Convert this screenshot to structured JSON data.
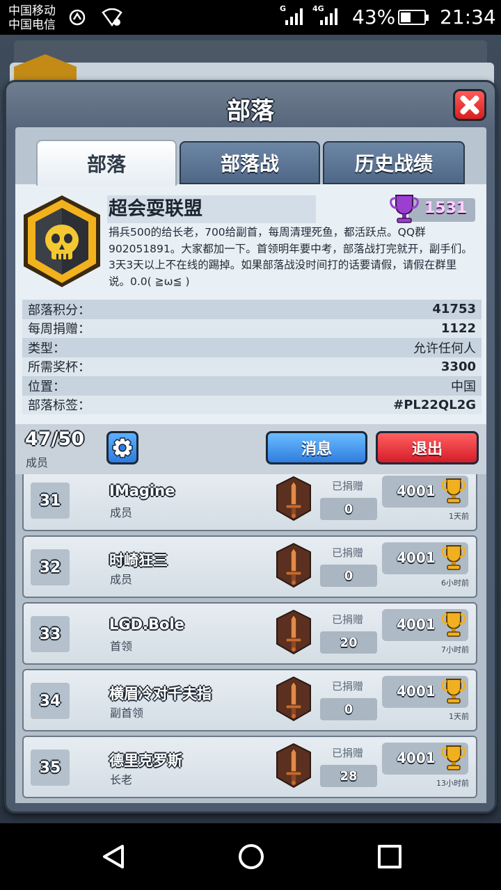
{
  "status_bar": {
    "carrier1": "中国移动",
    "carrier2": "中国电信",
    "signal1_tag": "G",
    "signal2_tag": "4G",
    "battery": "43%",
    "battery_level": 0.43,
    "time": "21:34"
  },
  "panel": {
    "title": "部落",
    "tabs": [
      {
        "label": "部落",
        "active": true
      },
      {
        "label": "部落战",
        "active": false
      },
      {
        "label": "历史战绩",
        "active": false
      }
    ]
  },
  "clan": {
    "name": "超会耍联盟",
    "trophies": "1531",
    "description": "捐兵500的给长老，700给副首，每周清理死鱼，都活跃点。QQ群902051891。大家都加一下。首领明年要中考，部落战打完就开，副手们。3天3天以上不在线的踢掉。如果部落战没时间打的话要请假，请假在群里说。0.0( ≧ω≦ )",
    "stats": [
      {
        "label": "部落积分：",
        "value": "41753"
      },
      {
        "label": "每周捐赠：",
        "value": "1122"
      },
      {
        "label": "类型：",
        "value": "允许任何人"
      },
      {
        "label": "所需奖杯：",
        "value": "3300"
      },
      {
        "label": "位置：",
        "value": "中国"
      },
      {
        "label": "部落标签：",
        "value": "#PL22QL2G"
      }
    ]
  },
  "members_bar": {
    "count": "47/50",
    "label": "成员",
    "message_button": "消息",
    "leave_button": "退出"
  },
  "members": [
    {
      "rank": "31",
      "name": "IMagine",
      "role": "成员",
      "donated_label": "已捐赠",
      "donated": "0",
      "trophies": "4001",
      "last_seen": "1天前"
    },
    {
      "rank": "32",
      "name": "时崎狂三",
      "role": "成员",
      "donated_label": "已捐赠",
      "donated": "0",
      "trophies": "4001",
      "last_seen": "6小时前"
    },
    {
      "rank": "33",
      "name": "LGD.Bole",
      "role": "首领",
      "donated_label": "已捐赠",
      "donated": "20",
      "trophies": "4001",
      "last_seen": "7小时前"
    },
    {
      "rank": "34",
      "name": "横眉冷对千夫指",
      "role": "副首领",
      "donated_label": "已捐赠",
      "donated": "0",
      "trophies": "4001",
      "last_seen": "1天前"
    },
    {
      "rank": "35",
      "name": "德里克罗斯",
      "role": "长老",
      "donated_label": "已捐赠",
      "donated": "28",
      "trophies": "4001",
      "last_seen": "13小时前"
    }
  ],
  "icons": {
    "clan_badge": "skull-shield-icon",
    "clan_trophy": "purple-trophy-icon",
    "member_sword": "sword-icon",
    "member_trophy": "gold-trophy-icon",
    "settings": "gear-icon",
    "close": "close-icon"
  },
  "colors": {
    "clan_trophy": "#9a3fd0",
    "member_trophy": "#f0b020",
    "leave_button": "#d41d2a",
    "message_button": "#2f7ddf"
  },
  "nav": {
    "back": "back-icon",
    "home": "home-icon",
    "recent": "recent-apps-icon"
  }
}
